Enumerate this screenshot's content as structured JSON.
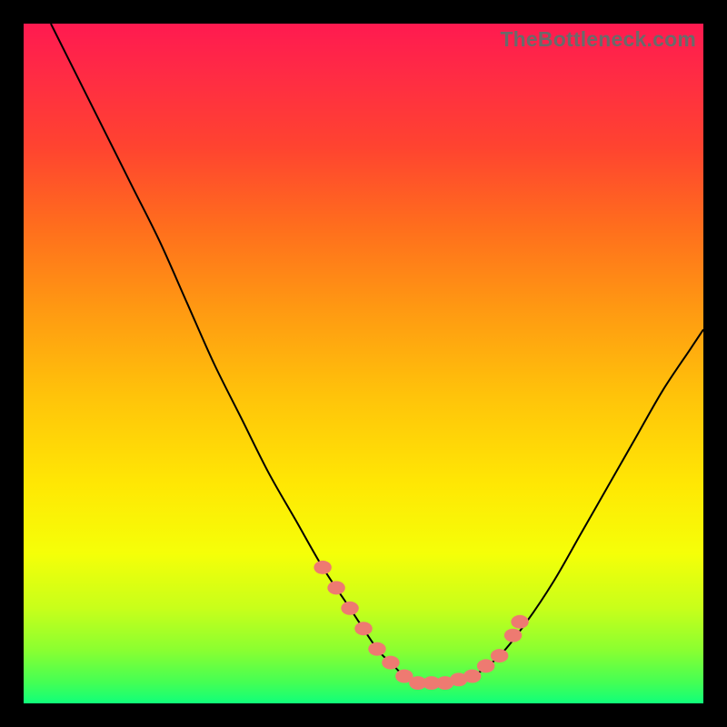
{
  "watermark": "TheBottleneck.com",
  "chart_data": {
    "type": "line",
    "title": "",
    "xlabel": "",
    "ylabel": "",
    "xlim": [
      0,
      100
    ],
    "ylim": [
      0,
      100
    ],
    "grid": false,
    "legend": false,
    "series": [
      {
        "name": "bottleneck-curve",
        "x": [
          4,
          8,
          12,
          16,
          20,
          24,
          28,
          32,
          36,
          40,
          44,
          48,
          52,
          54,
          56,
          58,
          60,
          62,
          66,
          70,
          74,
          78,
          82,
          86,
          90,
          94,
          98,
          100
        ],
        "y": [
          100,
          92,
          84,
          76,
          68,
          59,
          50,
          42,
          34,
          27,
          20,
          14,
          8,
          6,
          4,
          3,
          3,
          3,
          4,
          7,
          12,
          18,
          25,
          32,
          39,
          46,
          52,
          55
        ]
      }
    ],
    "markers": {
      "name": "highlight-points",
      "color": "#ee7a71",
      "x": [
        44,
        46,
        48,
        50,
        52,
        54,
        56,
        58,
        60,
        62,
        64,
        66,
        68,
        70,
        72,
        73
      ],
      "y": [
        20,
        17,
        14,
        11,
        8,
        6,
        4,
        3,
        3,
        3,
        3.5,
        4,
        5.5,
        7,
        10,
        12
      ]
    },
    "background_gradient": {
      "direction": "vertical",
      "stops": [
        {
          "pos": 0.0,
          "color": "#ff1a50"
        },
        {
          "pos": 0.18,
          "color": "#ff4330"
        },
        {
          "pos": 0.42,
          "color": "#ff9912"
        },
        {
          "pos": 0.68,
          "color": "#ffe804"
        },
        {
          "pos": 0.86,
          "color": "#c8ff1a"
        },
        {
          "pos": 1.0,
          "color": "#10ff7a"
        }
      ]
    }
  }
}
